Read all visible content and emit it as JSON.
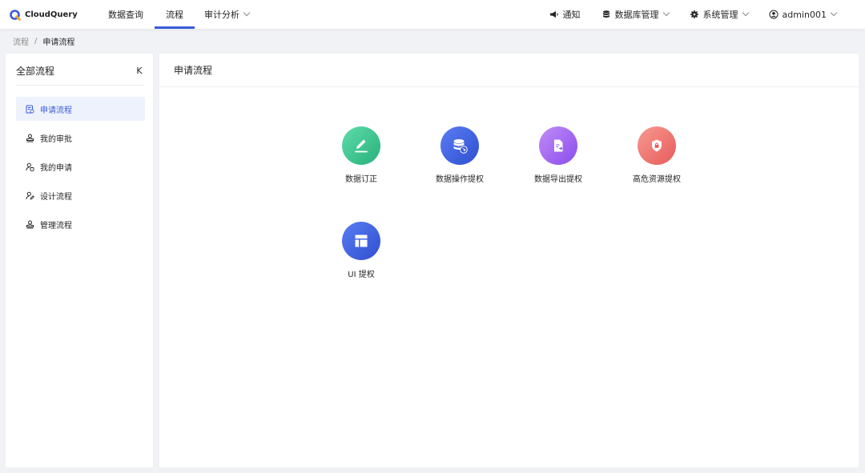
{
  "brand": {
    "name": "CloudQuery"
  },
  "nav": {
    "items": [
      {
        "label": "数据查询"
      },
      {
        "label": "流程"
      },
      {
        "label": "审计分析"
      }
    ]
  },
  "right_nav": {
    "notify": "通知",
    "db_manage": "数据库管理",
    "sys_manage": "系统管理",
    "user": "admin001"
  },
  "breadcrumb": {
    "parent": "流程",
    "separator": "/",
    "current": "申请流程"
  },
  "sidebar": {
    "title": "全部流程",
    "collapse_icon": "K",
    "items": [
      {
        "label": "申请流程"
      },
      {
        "label": "我的审批"
      },
      {
        "label": "我的申请"
      },
      {
        "label": "设计流程"
      },
      {
        "label": "管理流程"
      }
    ]
  },
  "main": {
    "title": "申请流程",
    "tiles": [
      {
        "label": "数据订正",
        "icon": "pencil-icon",
        "color": "#34c08a"
      },
      {
        "label": "数据操作提权",
        "icon": "database-cursor-icon",
        "color": "#3a5bdb"
      },
      {
        "label": "数据导出提权",
        "icon": "document-export-icon",
        "color": "#9b5cf0"
      },
      {
        "label": "高危资源提权",
        "icon": "shield-lock-icon",
        "color": "#f06a6a"
      },
      {
        "label": "UI 提权",
        "icon": "layout-icon",
        "color": "#3a5bdb"
      }
    ]
  },
  "colors": {
    "accent": "#3a5bdb",
    "active_bg": "#eef2fd"
  }
}
